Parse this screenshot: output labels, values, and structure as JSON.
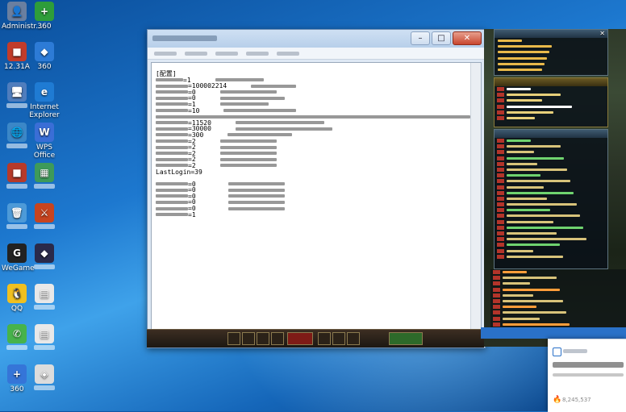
{
  "desktop": {
    "icons": [
      {
        "id": "admin",
        "label": "Administr..."
      },
      {
        "id": "safe360",
        "label": "360"
      },
      {
        "id": "app1",
        "label": "12.31A"
      },
      {
        "id": "app2",
        "label": "360"
      },
      {
        "id": "computer",
        "label": ""
      },
      {
        "id": "ie",
        "label": "Internet Explorer"
      },
      {
        "id": "network",
        "label": ""
      },
      {
        "id": "wps",
        "label": "WPS Office"
      },
      {
        "id": "app3",
        "label": ""
      },
      {
        "id": "app4",
        "label": ""
      },
      {
        "id": "recycle",
        "label": ""
      },
      {
        "id": "app5",
        "label": ""
      },
      {
        "id": "app6",
        "label": "WeGame"
      },
      {
        "id": "app7",
        "label": ""
      },
      {
        "id": "qq",
        "label": "QQ"
      },
      {
        "id": "doc1",
        "label": ""
      },
      {
        "id": "wechat",
        "label": ""
      },
      {
        "id": "doc2",
        "label": ""
      },
      {
        "id": "safe360b",
        "label": "360"
      },
      {
        "id": "doc3",
        "label": ""
      }
    ]
  },
  "notepad": {
    "title": "",
    "menu": [
      "",
      "",
      "",
      "",
      ""
    ],
    "lines": [
      {
        "text": "[配置]"
      },
      {
        "text": "=1"
      },
      {
        "text": "=100002214"
      },
      {
        "text": "=0"
      },
      {
        "text": "=0"
      },
      {
        "text": "=1"
      },
      {
        "text": "=10"
      },
      {
        "text": ""
      },
      {
        "text": "=11520"
      },
      {
        "text": "=30000"
      },
      {
        "text": "=300"
      },
      {
        "text": "=2"
      },
      {
        "text": "=2"
      },
      {
        "text": "=2"
      },
      {
        "text": "=2"
      },
      {
        "text": "=2"
      },
      {
        "text": "LastLogin=39"
      },
      {
        "text": ""
      },
      {
        "text": "=0"
      },
      {
        "text": "=0"
      },
      {
        "text": "=0"
      },
      {
        "text": "=0"
      },
      {
        "text": "=0"
      },
      {
        "text": "=1"
      }
    ]
  },
  "game": {
    "notification": {
      "count": "8,245,537"
    }
  }
}
